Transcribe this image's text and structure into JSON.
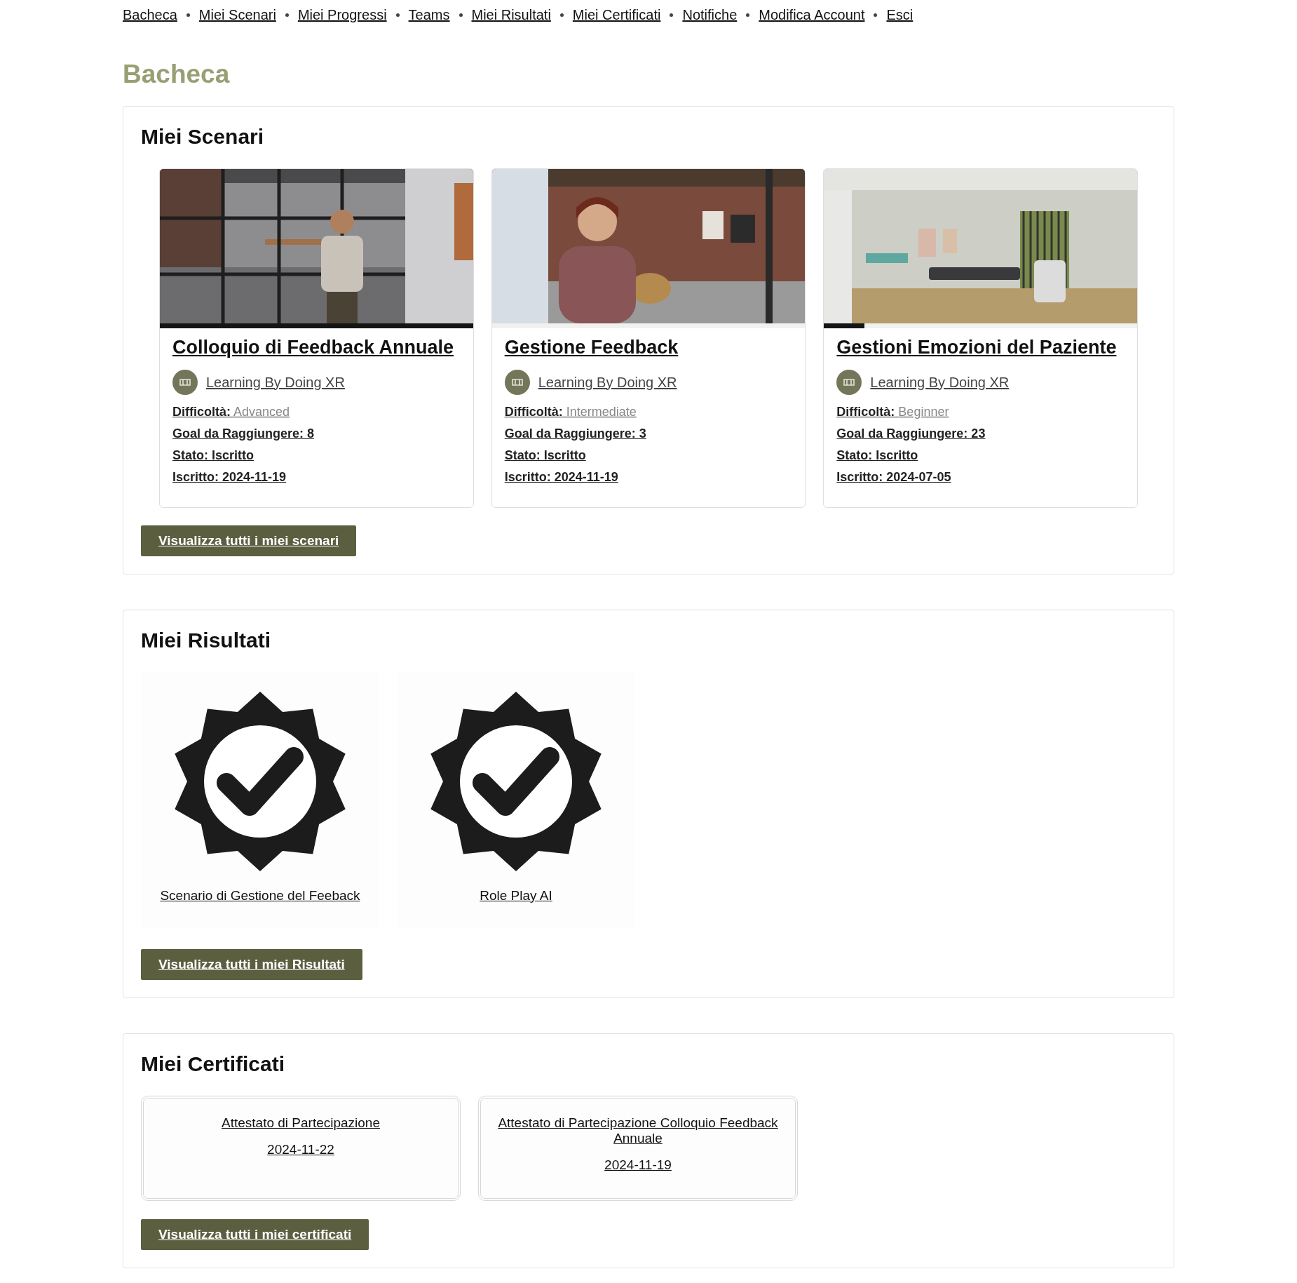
{
  "nav": [
    {
      "label": "Bacheca"
    },
    {
      "label": "Miei Scenari"
    },
    {
      "label": "Miei Progressi"
    },
    {
      "label": "Teams"
    },
    {
      "label": "Miei Risultati"
    },
    {
      "label": "Miei Certificati"
    },
    {
      "label": "Notifiche"
    },
    {
      "label": "Modifica Account"
    },
    {
      "label": "Esci"
    }
  ],
  "page_title": "Bacheca",
  "scenarios": {
    "title": "Miei Scenari",
    "items": [
      {
        "kind": "office",
        "level": 1,
        "title": "Colloquio di Feedback Annuale",
        "author": "Learning By Doing XR",
        "difficulty_label": "Difficoltà:",
        "difficulty": "Advanced",
        "goal": "Goal da Raggiungere: 8",
        "status": "Stato: Iscritto",
        "enrolled": "Iscritto: 2024-11-19"
      },
      {
        "kind": "lounge",
        "level": 0,
        "title": "Gestione Feedback",
        "author": "Learning By Doing XR",
        "difficulty_label": "Difficoltà:",
        "difficulty": "Intermediate",
        "goal": "Goal da Raggiungere: 3",
        "status": "Stato: Iscritto",
        "enrolled": "Iscritto: 2024-11-19"
      },
      {
        "kind": "clinic",
        "level": 0.13,
        "title": "Gestioni Emozioni del Paziente",
        "author": "Learning By Doing XR",
        "difficulty_label": "Difficoltà:",
        "difficulty": "Beginner",
        "goal": "Goal da Raggiungere: 23",
        "status": "Stato: Iscritto",
        "enrolled": "Iscritto: 2024-07-05"
      }
    ],
    "button": "Visualizza tutti i miei scenari"
  },
  "results": {
    "title": "Miei Risultati",
    "items": [
      {
        "label": "Scenario di Gestione del Feeback"
      },
      {
        "label": "Role Play AI"
      }
    ],
    "button": "Visualizza tutti i miei Risultati"
  },
  "certificates": {
    "title": "Miei Certificati",
    "items": [
      {
        "name": "Attestato di Partecipazione",
        "date": "2024-11-22"
      },
      {
        "name": "Attestato di Partecipazione Colloquio Feedback Annuale",
        "date": "2024-11-19"
      }
    ],
    "button": "Visualizza tutti i miei certificati"
  }
}
